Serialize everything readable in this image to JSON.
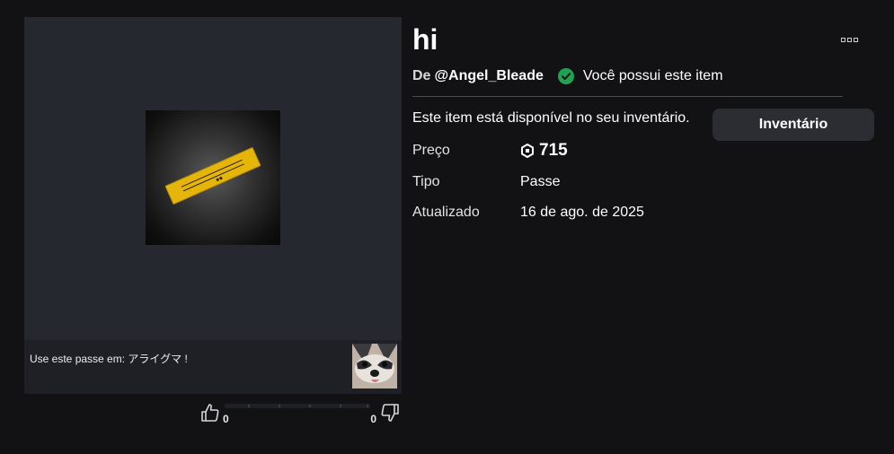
{
  "item": {
    "title": "hi",
    "creator_prefix": "De",
    "creator_name": "@Angel_Bleade",
    "owned_text": "Você possui este item",
    "availability_text": "Este item está disponível no seu inventário.",
    "inventory_button": "Inventário",
    "details": {
      "price_label": "Preço",
      "price_value": "715",
      "type_label": "Tipo",
      "type_value": "Passe",
      "updated_label": "Atualizado",
      "updated_value": "16 de ago. de 2025"
    }
  },
  "use_in": {
    "text": "Use este passe em: アライグマ !"
  },
  "votes": {
    "up_count": "0",
    "down_count": "0"
  },
  "colors": {
    "background": "#121215",
    "card": "#25282f",
    "owned_green": "#1fa352",
    "ticket_gold": "#e5b609"
  },
  "icons": [
    "thumbs-up-icon",
    "thumbs-down-icon",
    "robux-icon",
    "checkmark-circle-icon",
    "more-options-icon"
  ]
}
